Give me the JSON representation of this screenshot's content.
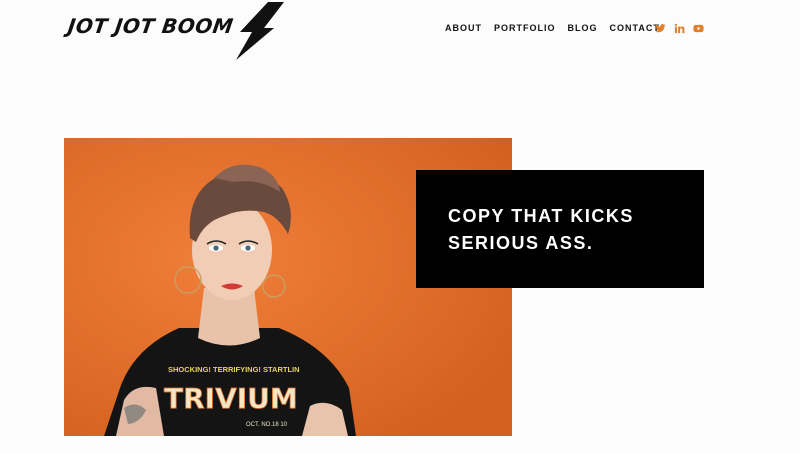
{
  "brand": {
    "logo_text": "JOT JOT BOOM"
  },
  "nav": {
    "items": [
      {
        "label": "ABOUT"
      },
      {
        "label": "PORTFOLIO"
      },
      {
        "label": "BLOG"
      },
      {
        "label": "CONTACT"
      }
    ]
  },
  "social": {
    "color": "#e0802a",
    "icons": [
      "twitter-icon",
      "linkedin-icon",
      "youtube-icon"
    ]
  },
  "hero": {
    "background_color": "#e3702b",
    "shirt_text_top": "SHOCKING! TERRIFYING! STARTLIN",
    "shirt_text_main": "TRIVIUM",
    "shirt_text_date": "OCT. NO.18 10"
  },
  "headline": {
    "line1": "COPY THAT KICKS",
    "line2": "SERIOUS ASS.",
    "box_color": "#000000"
  }
}
